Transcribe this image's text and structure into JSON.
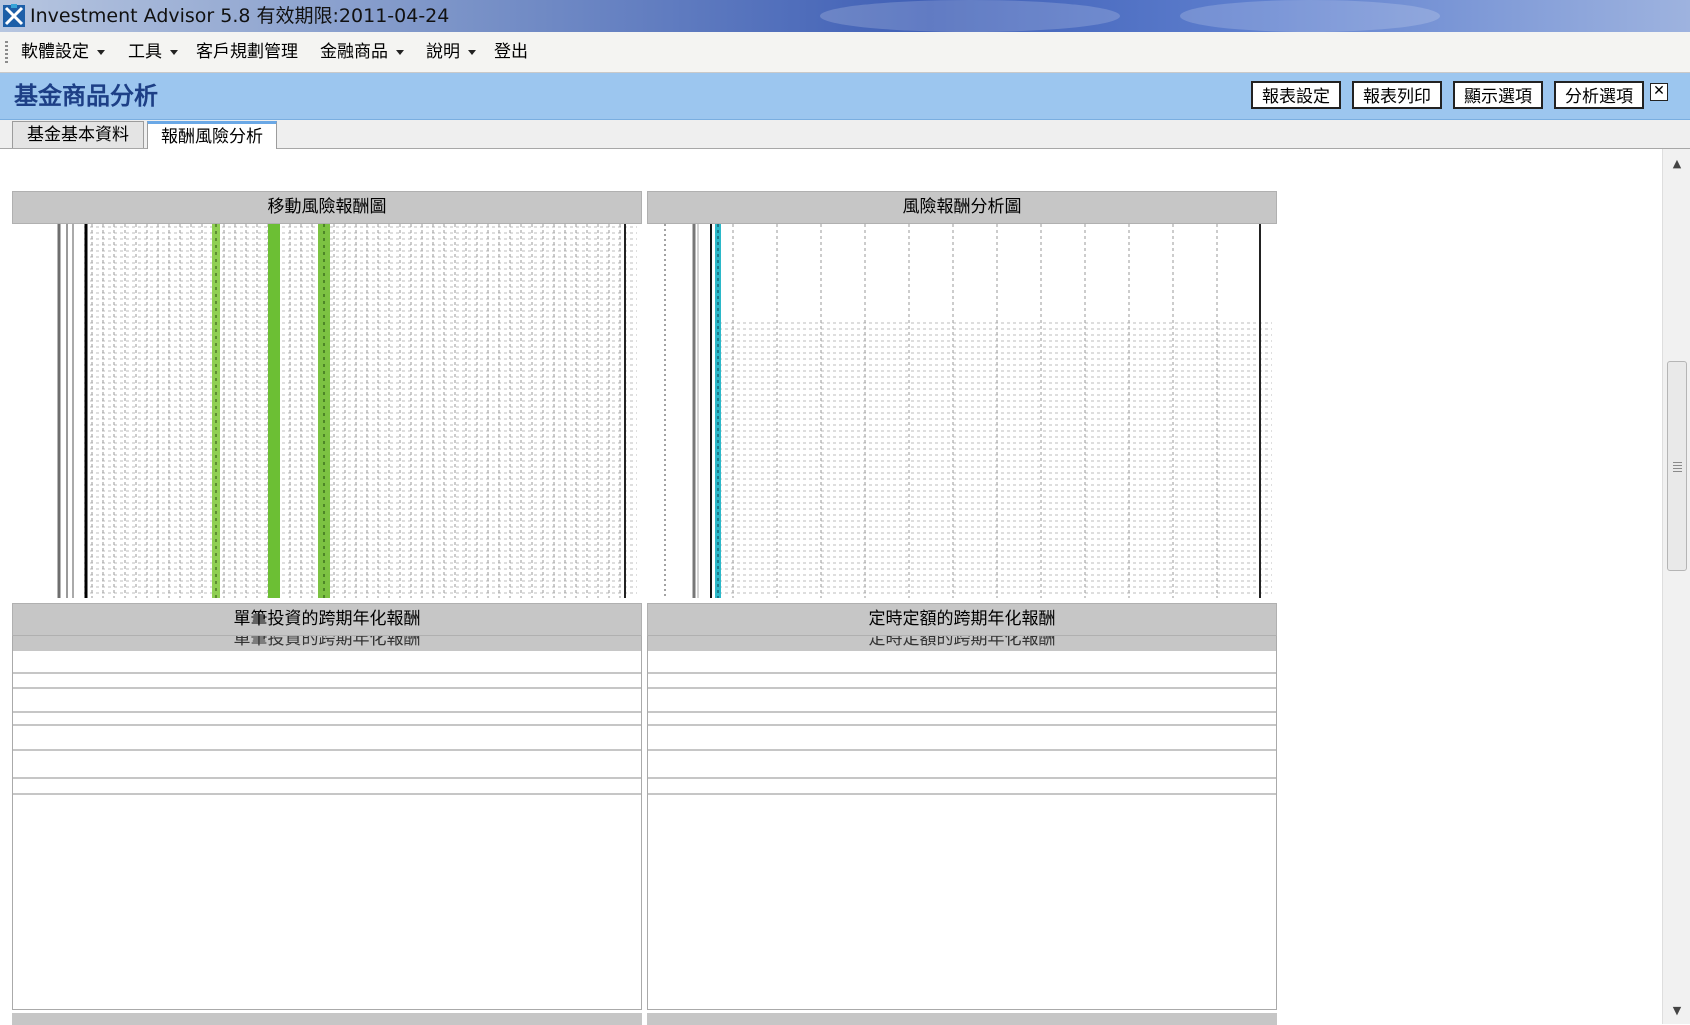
{
  "window": {
    "title": "Investment Advisor 5.8 有效期限:2011-04-24"
  },
  "menu": {
    "items": [
      {
        "label": "軟體設定",
        "dropdown": true
      },
      {
        "label": "工具",
        "dropdown": true
      },
      {
        "label": "客戶規劃管理",
        "dropdown": false
      },
      {
        "label": "金融商品",
        "dropdown": true
      },
      {
        "label": "說明",
        "dropdown": true
      },
      {
        "label": "登出",
        "dropdown": false
      }
    ]
  },
  "header": {
    "title": "基金商品分析",
    "buttons": [
      "報表設定",
      "報表列印",
      "顯示選項",
      "分析選項"
    ]
  },
  "tabs": [
    {
      "label": "基金基本資料",
      "active": false
    },
    {
      "label": "報酬風險分析",
      "active": true
    }
  ],
  "panels": {
    "moving_risk_return": {
      "title": "移動風險報酬圖"
    },
    "risk_return_analysis": {
      "title": "風險報酬分析圖"
    },
    "lump_sum_annualized": {
      "title": "單筆投資的跨期年化報酬",
      "ghost_title": "單筆投資的跨期年化報酬"
    },
    "regular_annualized": {
      "title": "定時定額的跨期年化報酬",
      "ghost_title": "定時定額的跨期年化報酬"
    }
  },
  "colors": {
    "header_bg": "#9cc6ef",
    "title_blue": "#1d3f86",
    "panel_gray": "#c6c6c6",
    "series_green": "#7cc242",
    "series_teal": "#2bb8c9"
  }
}
